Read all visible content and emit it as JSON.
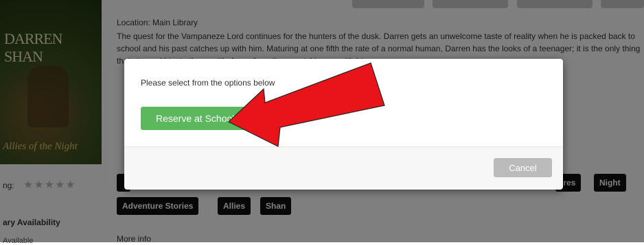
{
  "book": {
    "cover_author": "DARREN SHAN",
    "cover_title": "Allies of the Night",
    "location": "Location: Main Library",
    "description": "The quest for the Vampaneze Lord continues for the hunters of the dusk. Darren gets an unwelcome taste of reality when he is packed back to school and his past catches up with him. Maturing at one fifth the rate of a normal human, Darren has the looks of a teenager; it is the only thing that stopped him to the ... with; faces from the ... catching up with him ...",
    "rating_label": "ng:",
    "stars": "★★★★★",
    "availability_label": "ary Availability",
    "availability_sub": "Available",
    "more_info": "More info"
  },
  "tags": [
    "Night",
    "Adventure Stories",
    "Allies",
    "Shan",
    "ires"
  ],
  "modal": {
    "prompt": "Please select from the options below",
    "reserve_label": "Reserve at School",
    "cancel_label": "Cancel"
  },
  "colors": {
    "reserve": "#5cb85c",
    "cancel": "#bbbbbb",
    "arrow": "#e8141a"
  },
  "icons": [
    "red-arrow-annotation"
  ]
}
